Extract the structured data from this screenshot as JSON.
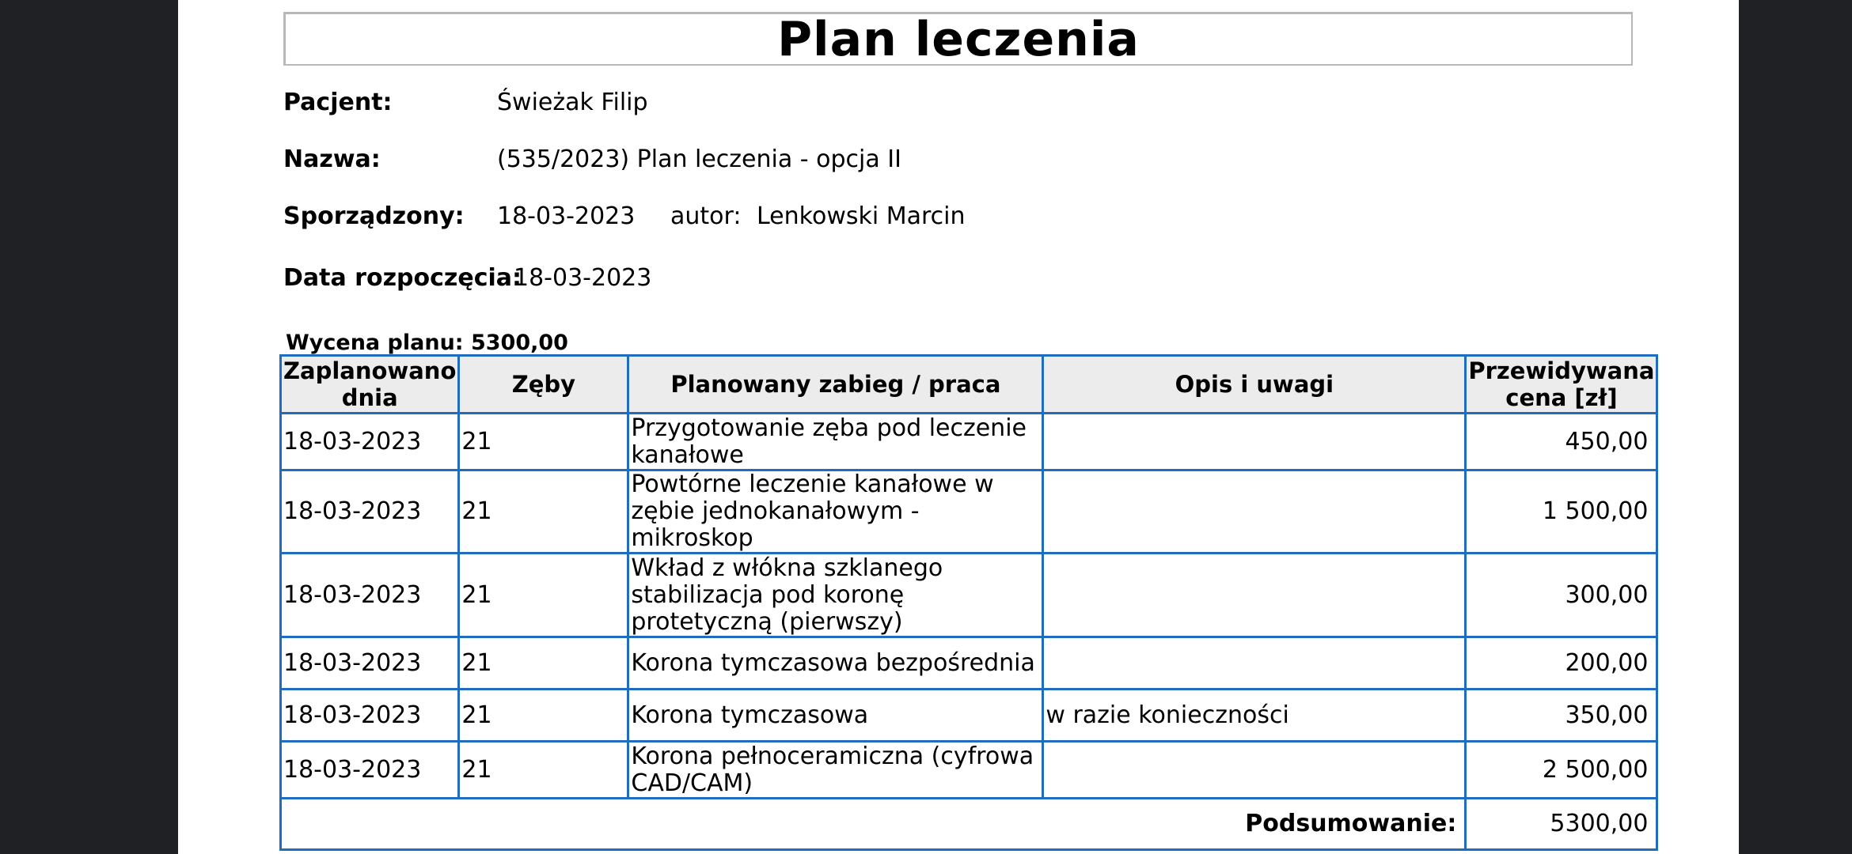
{
  "document": {
    "title": "Plan leczenia",
    "patient_label": "Pacjent:",
    "patient_value": "Świeżak Filip",
    "name_label": "Nazwa:",
    "name_value": "(535/2023) Plan leczenia - opcja II",
    "created_label": "Sporządzony:",
    "created_date": "18-03-2023",
    "author_label": "autor:",
    "author_value": "Lenkowski Marcin",
    "start_label": "Data rozpoczęcia:",
    "start_value": "18-03-2023",
    "valuation": "Wycena planu: 5300,00"
  },
  "table": {
    "headers": {
      "date": "Zaplanowano dnia",
      "teeth": "Zęby",
      "procedure": "Planowany zabieg / praca",
      "notes": "Opis i uwagi",
      "price": "Przewidywana cena [zł]"
    },
    "rows": [
      {
        "date": "18-03-2023",
        "tooth": "21",
        "procedure": "Przygotowanie zęba pod leczenie kanałowe",
        "notes": "",
        "price": "450,00"
      },
      {
        "date": "18-03-2023",
        "tooth": "21",
        "procedure": "Powtórne leczenie kanałowe w zębie jednokanałowym - mikroskop",
        "notes": "",
        "price": "1 500,00"
      },
      {
        "date": "18-03-2023",
        "tooth": "21",
        "procedure": "Wkład z włókna szklanego stabilizacja pod koronę protetyczną (pierwszy)",
        "notes": "",
        "price": "300,00"
      },
      {
        "date": "18-03-2023",
        "tooth": "21",
        "procedure": "Korona tymczasowa bezpośrednia",
        "notes": "",
        "price": "200,00"
      },
      {
        "date": "18-03-2023",
        "tooth": "21",
        "procedure": "Korona tymczasowa",
        "notes": "w razie konieczności",
        "price": "350,00"
      },
      {
        "date": "18-03-2023",
        "tooth": "21",
        "procedure": "Korona pełnoceramiczna (cyfrowa CAD/CAM)",
        "notes": "",
        "price": "2 500,00"
      }
    ],
    "summary_label": "Podsumowanie:",
    "summary_value": "5300,00"
  },
  "colors": {
    "border": "#1f6cc0",
    "header_bg": "#ececec",
    "viewer_bg": "#202124"
  }
}
